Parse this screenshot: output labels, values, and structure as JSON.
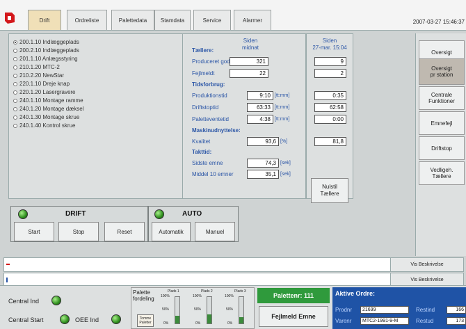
{
  "header": {
    "tabs": [
      "Drift",
      "Ordreliste",
      "Palettedata",
      "Stamdata",
      "Service",
      "Alarmer"
    ],
    "active_tab": "Drift",
    "datetime": "2007-03-27 15:46:37"
  },
  "stations": [
    {
      "label": "200.1.10 Indlæggeplads",
      "selected": true
    },
    {
      "label": "200.2.10 Indlæggeplads",
      "selected": false
    },
    {
      "label": "201.1.10 Anlægsstyring",
      "selected": false
    },
    {
      "label": "210.1.20 MTC-2",
      "selected": false
    },
    {
      "label": "210.2.20 NewStar",
      "selected": false
    },
    {
      "label": "220.1.10 Dreje knap",
      "selected": false
    },
    {
      "label": "220.1.20 Lasergravere",
      "selected": false
    },
    {
      "label": "240.1.10 Montage ramme",
      "selected": false
    },
    {
      "label": "240.1.20 Montage dæksel",
      "selected": false
    },
    {
      "label": "240.1.30 Montage skrue",
      "selected": false
    },
    {
      "label": "240.1.40 Kontrol skrue",
      "selected": false
    }
  ],
  "counters": {
    "col1_header_line1": "Siden",
    "col1_header_line2": "midnat",
    "col2_header_line1": "Siden",
    "col2_header_line2": "27-mar. 15:04",
    "sections": {
      "taellere": "Tællere:",
      "tidsforbrug": "Tidsforbrug:",
      "maskinudnyttelse": "Maskinudnyttelse:",
      "takttid": "Takttid:"
    },
    "rows": {
      "produceret": {
        "label": "Produceret gode",
        "v1": "321",
        "v2": "9"
      },
      "fejlmeldt": {
        "label": "Fejlmeldt",
        "v1": "22",
        "v2": "2"
      },
      "produktionstid": {
        "label": "Produktionstid",
        "v1": "9:10",
        "u1": "[tt:mm]",
        "v2": "0:35"
      },
      "driftstoptid": {
        "label": "Driftstoptid",
        "v1": "63:33",
        "u1": "[tt:mm]",
        "v2": "62:58"
      },
      "paletteventetid": {
        "label": "Paletteventetid",
        "v1": "4:38",
        "u1": "[tt:mm]",
        "v2": "0:00"
      },
      "kvalitet": {
        "label": "Kvalitet",
        "v1": "93,6",
        "u1": "[%]",
        "v2": "81,8"
      },
      "sidste_emne": {
        "label": "Sidste emne",
        "v1": "74,3",
        "u1": "[sek]"
      },
      "middel": {
        "label": "Middel 10 emner",
        "v1": "35,1",
        "u1": "[sek]"
      }
    },
    "reset_label_line1": "Nulstil",
    "reset_label_line2": "Tællere"
  },
  "nav": [
    {
      "line1": "Oversigt",
      "line2": "",
      "active": false
    },
    {
      "line1": "Oversigt",
      "line2": "pr station",
      "active": true
    },
    {
      "line1": "Centrale",
      "line2": "Funktioner",
      "active": false
    },
    {
      "line1": "Emnefejl",
      "line2": "",
      "active": false
    },
    {
      "line1": "Driftstop",
      "line2": "",
      "active": false
    },
    {
      "line1": "Vedligeh.",
      "line2": "Tællere",
      "active": false
    }
  ],
  "drift": {
    "title": "DRIFT",
    "start": "Start",
    "stop": "Stop",
    "reset": "Reset"
  },
  "auto": {
    "title": "AUTO",
    "automatik": "Automatik",
    "manuel": "Manuel"
  },
  "messages": {
    "show_desc_1": "Vis Beskrivelse",
    "show_desc_2": "Vis Beskrivelse"
  },
  "bottom": {
    "central_ind": "Central Ind",
    "central_start": "Central Start",
    "oee_ind": "OEE Ind",
    "palette_fordeling_line1": "Palette",
    "palette_fordeling_line2": "fordeling",
    "tomme_line1": "Tomme",
    "tomme_line2": "Paletter",
    "plads1": "Plads 1",
    "plads2": "Plads 2",
    "plads3": "Plads 3",
    "pct100": "100%",
    "pct50": "50%",
    "pct0": "0%",
    "gauge_levels": [
      0.3,
      0.35,
      0.25
    ],
    "palette_no": "Palettenr: 111",
    "fejlmeld_emne": "Fejlmeld Emne",
    "orders_title": "Aktive Ordre:",
    "prodnr_label": "Prodnr",
    "prodnr_value": "21699",
    "varenr_label": "Varenr",
    "varenr_value": "MTC2-1991-9-M",
    "restind_label": "Restind",
    "restind_value": "166",
    "restud_label": "Restud",
    "restud_value": "173"
  },
  "colors": {
    "accent_blue": "#2a55a6",
    "ok_green": "#2f9a3c",
    "order_panel": "#1f53a6",
    "alarm_red": "#d01818"
  }
}
